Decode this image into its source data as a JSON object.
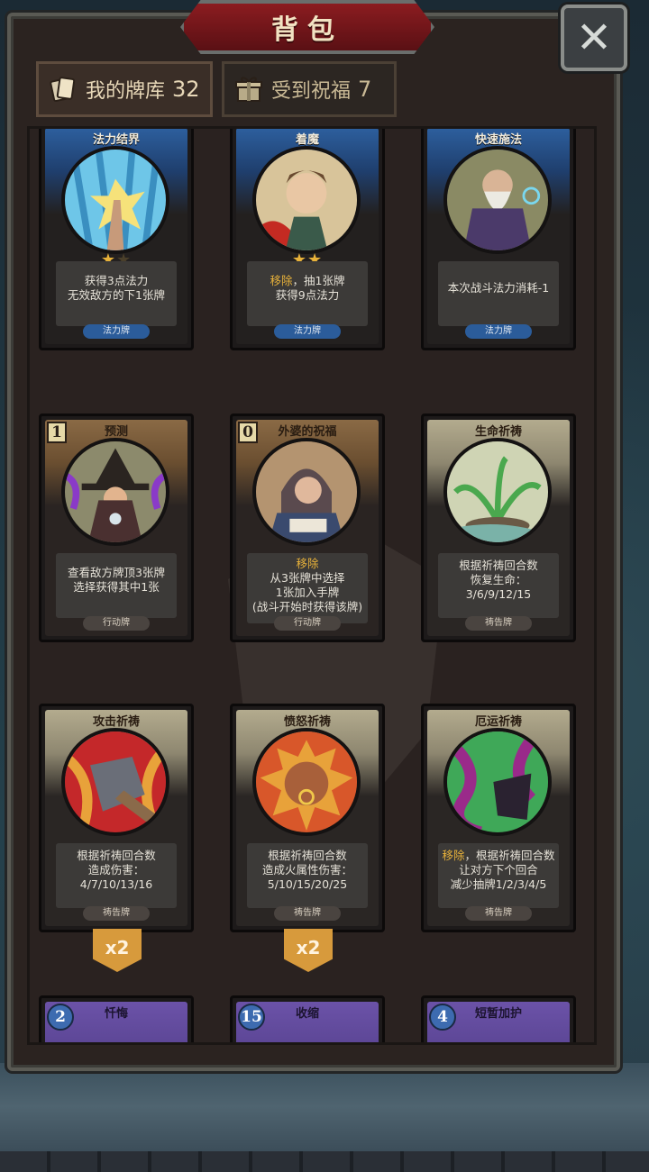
{
  "title": "背包",
  "tabs": [
    {
      "label": "我的牌库",
      "count": "32",
      "active": true
    },
    {
      "label": "受到祝福",
      "count": "7",
      "active": false
    }
  ],
  "cards": [
    {
      "name": "法力结界",
      "stars": 1,
      "max_stars": 2,
      "desc_hl": "",
      "desc_1": "获得3点法力",
      "desc_2": "无效敌方的下1张牌",
      "desc_3": "",
      "type": "法力牌"
    },
    {
      "name": "着魔",
      "stars": 2,
      "max_stars": 2,
      "desc_hl": "移除",
      "desc_1": "，抽1张牌",
      "desc_2": "获得9点法力",
      "desc_3": "",
      "type": "法力牌"
    },
    {
      "name": "快速施法",
      "stars": 0,
      "max_stars": 0,
      "desc_hl": "",
      "desc_1": "本次战斗法力消耗-1",
      "desc_2": "",
      "desc_3": "",
      "type": "法力牌"
    },
    {
      "name": "预测",
      "cost": "1",
      "desc_hl": "",
      "desc_1": "查看敌方牌顶3张牌",
      "desc_2": "选择获得其中1张",
      "desc_3": "",
      "type": "行动牌"
    },
    {
      "name": "外婆的祝福",
      "cost": "0",
      "desc_hl": "移除",
      "desc_1": "从3张牌中选择",
      "desc_2": "1张加入手牌",
      "desc_3": "(战斗开始时获得该牌)",
      "type": "行动牌"
    },
    {
      "name": "生命祈祷",
      "desc_hl": "",
      "desc_1": "根据祈祷回合数",
      "desc_2": "恢复生命：",
      "desc_3": "3/6/9/12/15",
      "type": "祷告牌"
    },
    {
      "name": "攻击祈祷",
      "desc_hl": "",
      "desc_1": "根据祈祷回合数",
      "desc_2": "造成伤害：",
      "desc_3": "4/7/10/13/16",
      "type": "祷告牌",
      "mult": "x2"
    },
    {
      "name": "愤怒祈祷",
      "desc_hl": "",
      "desc_1": "根据祈祷回合数",
      "desc_2": "造成火属性伤害：",
      "desc_3": "5/10/15/20/25",
      "type": "祷告牌",
      "mult": "x2"
    },
    {
      "name": "厄运祈祷",
      "desc_hl": "移除",
      "desc_1": "，根据祈祷回合数",
      "desc_2": "让对方下个回合",
      "desc_3": "减少抽牌1/2/3/4/5",
      "type": "祷告牌"
    },
    {
      "name": "忏悔",
      "cost": "2"
    },
    {
      "name": "收缩",
      "cost": "15"
    },
    {
      "name": "短暂加护",
      "cost": "4"
    }
  ],
  "colors": {
    "accent": "#e8b23a",
    "blue_frame": "#2d5f9e",
    "title_red": "#8b1c20"
  },
  "icons": {
    "close": "close-icon",
    "deck": "card-deck-icon",
    "gift": "gift-icon"
  }
}
